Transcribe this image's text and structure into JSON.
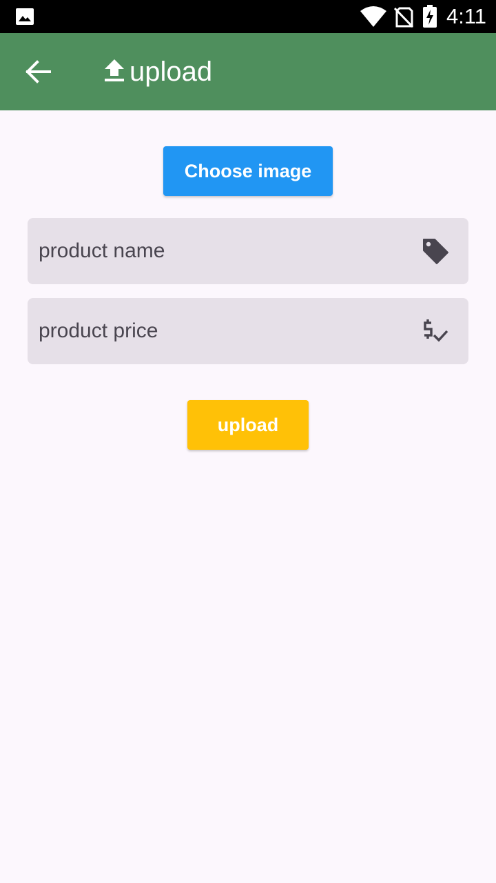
{
  "status_bar": {
    "time": "4:11",
    "icons": [
      "gallery-icon",
      "wifi-icon",
      "no-sim-icon",
      "battery-charging-icon"
    ]
  },
  "app_bar": {
    "back_icon": "arrow-back-icon",
    "title_icon": "upload-icon",
    "title": "upload",
    "color": "#4f8f5d"
  },
  "form": {
    "choose_image_label": "Choose image",
    "choose_image_color": "#2196f3",
    "product_name_placeholder": "product name",
    "product_name_icon": "tag-icon",
    "product_price_placeholder": "product price",
    "product_price_icon": "price-check-icon",
    "upload_label": "upload",
    "upload_color": "#ffc107"
  }
}
